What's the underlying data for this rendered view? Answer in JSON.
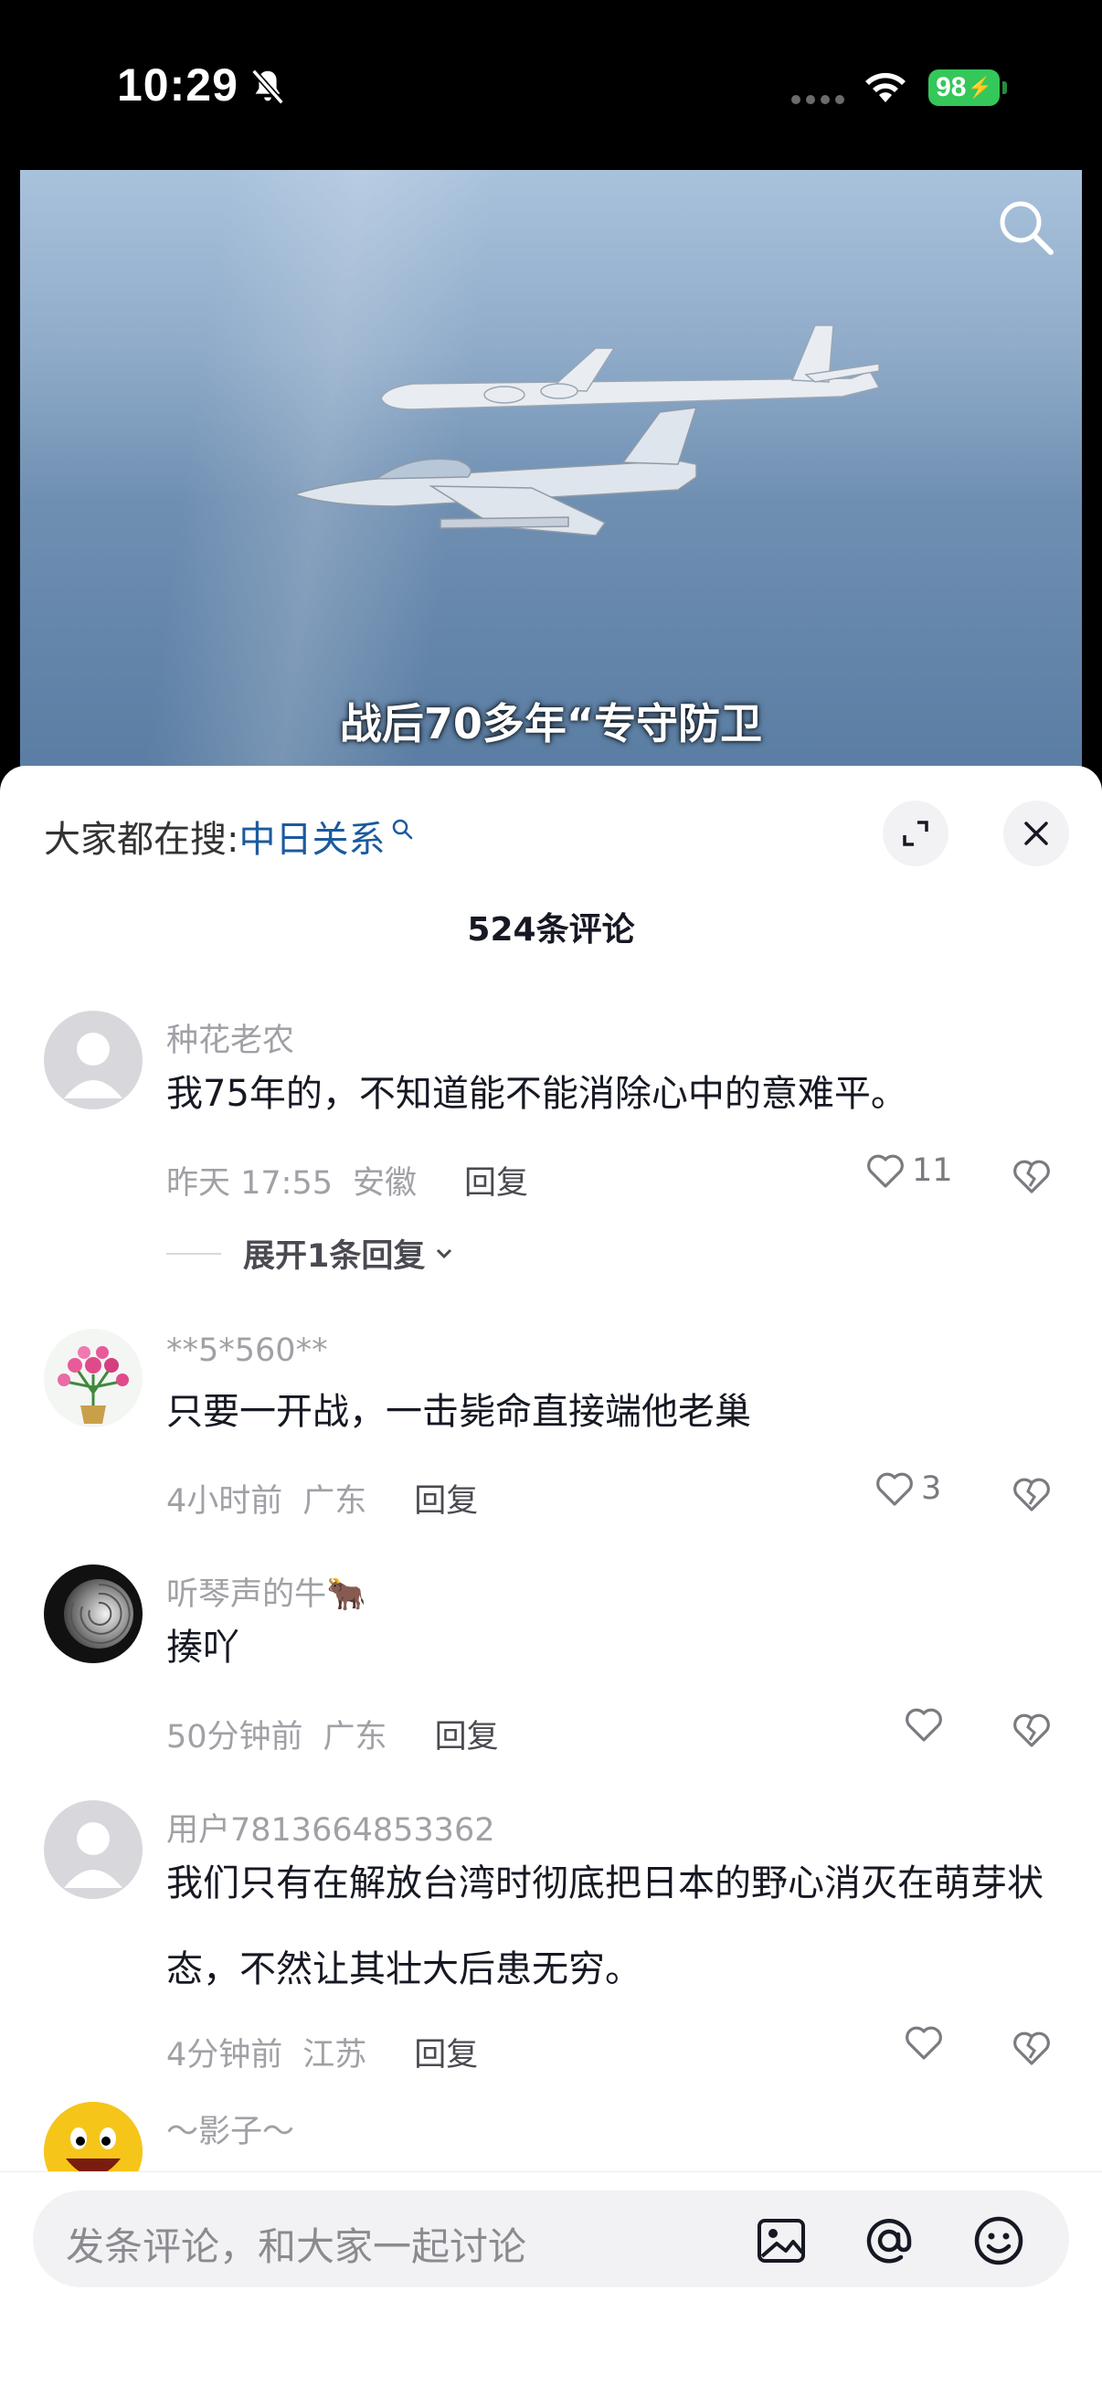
{
  "status_bar": {
    "time": "10:29",
    "battery": "98"
  },
  "video": {
    "subtitle": "战后70多年“专守防卫"
  },
  "panel": {
    "search_prefix": "大家都在搜:",
    "search_keyword": "中日关系",
    "comment_count": "524条评论"
  },
  "comments": [
    {
      "username": "种花老农",
      "text": "我75年的，不知道能不能消除心中的意难平。",
      "time": "昨天 17:55",
      "location": "安徽",
      "reply": "回复",
      "likes": "11",
      "expand": "展开1条回复"
    },
    {
      "username": "**5*560**",
      "text": "只要一开战，一击毙命直接端他老巢",
      "time": "4小时前",
      "location": "广东",
      "reply": "回复",
      "likes": "3"
    },
    {
      "username": "听琴声的牛🐂",
      "text": "揍吖",
      "time": "50分钟前",
      "location": "广东",
      "reply": "回复",
      "likes": ""
    },
    {
      "username": "用户7813664853362",
      "text": "我们只有在解放台湾时彻底把日本的野心消灭在萌芽状态，不然让其壮大后患无穷。",
      "time": "4分钟前",
      "location": "江苏",
      "reply": "回复",
      "likes": ""
    },
    {
      "username": "～影子～"
    }
  ],
  "input": {
    "placeholder": "发条评论，和大家一起讨论"
  },
  "icons": [
    "bell-off-icon",
    "wifi-icon",
    "search-icon",
    "expand-icon",
    "close-icon",
    "heart-icon",
    "broken-heart-icon",
    "chevron-down-icon",
    "image-icon",
    "at-icon",
    "emoji-icon"
  ],
  "colors": {
    "accent_link": "#1b5a9e",
    "muted": "#a0a0a6",
    "battery": "#34c759"
  }
}
